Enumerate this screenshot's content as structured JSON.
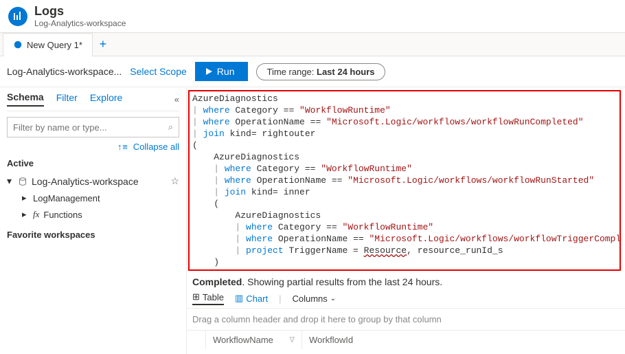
{
  "header": {
    "title": "Logs",
    "subtitle": "Log-Analytics-workspace"
  },
  "tabs": {
    "active": "New Query 1*"
  },
  "toolbar": {
    "scope": "Log-Analytics-workspace...",
    "select_scope": "Select Scope",
    "run": "Run",
    "time_label": "Time range:",
    "time_value": "Last 24 hours"
  },
  "sidebar": {
    "tabs": {
      "schema": "Schema",
      "filter": "Filter",
      "explore": "Explore"
    },
    "search_placeholder": "Filter by name or type...",
    "collapse_all": "Collapse all",
    "active_label": "Active",
    "workspace": "Log-Analytics-workspace",
    "children": {
      "log_mgmt": "LogManagement",
      "functions": "Functions"
    },
    "favorites_label": "Favorite workspaces"
  },
  "query": {
    "l1": "AzureDiagnostics",
    "l2a": "where",
    "l2b": " Category == ",
    "l2c": "\"WorkflowRuntime\"",
    "l3a": "where",
    "l3b": " OperationName == ",
    "l3c": "\"Microsoft.Logic/workflows/workflowRunCompleted\"",
    "l4a": "join",
    "l4b": " kind= rightouter",
    "l5": "(",
    "l6": "    AzureDiagnostics",
    "l7a": "where",
    "l7b": " Category == ",
    "l7c": "\"WorkflowRuntime\"",
    "l8a": "where",
    "l8b": " OperationName == ",
    "l8c": "\"Microsoft.Logic/workflows/workflowRunStarted\"",
    "l9a": "join",
    "l9b": " kind= inner",
    "l10": "    (",
    "l11": "        AzureDiagnostics",
    "l12a": "where",
    "l12b": " Category == ",
    "l12c": "\"WorkflowRuntime\"",
    "l13a": "where",
    "l13b": " OperationName == ",
    "l13c": "\"Microsoft.Logic/workflows/workflowTriggerCompleted\"",
    "l14a": "project",
    "l14b": " TriggerName = ",
    "l14c": "Resource",
    "l14d": ", resource_runId_s",
    "l15": "    )"
  },
  "results": {
    "status_bold": "Completed",
    "status_rest": ". Showing partial results from the last 24 hours.",
    "tab_table": "Table",
    "tab_chart": "Chart",
    "columns": "Columns",
    "group_hint": "Drag a column header and drop it here to group by that column",
    "cols": {
      "c1": "WorkflowName",
      "c2": "WorkflowId"
    }
  }
}
